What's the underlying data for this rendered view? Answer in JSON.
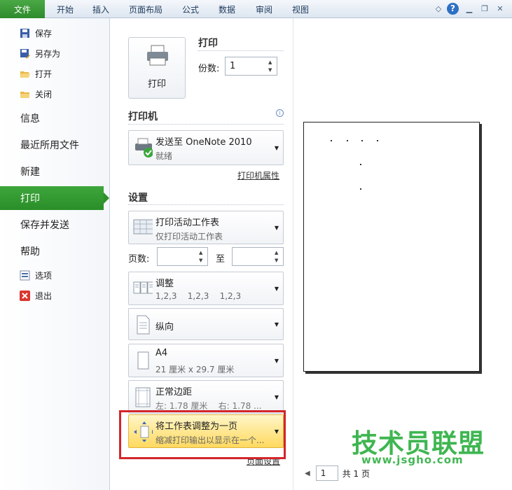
{
  "ribbon": {
    "file": "文件",
    "tabs": [
      "开始",
      "插入",
      "页面布局",
      "公式",
      "数据",
      "审阅",
      "视图"
    ]
  },
  "nav": {
    "small_top": [
      "保存",
      "另存为",
      "打开",
      "关闭"
    ],
    "big": [
      "信息",
      "最近所用文件",
      "新建",
      "打印",
      "保存并发送",
      "帮助"
    ],
    "small_bottom": [
      "选项",
      "退出"
    ]
  },
  "print": {
    "title": "打印",
    "button_label": "打印",
    "copies_label": "份数:",
    "copies_value": "1"
  },
  "printer": {
    "title": "打印机",
    "name": "发送至 OneNote 2010",
    "status": "就绪",
    "properties_link": "打印机属性"
  },
  "settings": {
    "title": "设置",
    "what": {
      "title": "打印活动工作表",
      "desc": "仅打印活动工作表"
    },
    "pages_label": "页数:",
    "to_label": "至",
    "collate": {
      "title": "调整",
      "desc": "1,2,3    1,2,3    1,2,3"
    },
    "orientation": {
      "title": "纵向"
    },
    "paper": {
      "title": "A4",
      "desc": "21 厘米 x 29.7 厘米"
    },
    "margins": {
      "title": "正常边距",
      "desc": "左: 1.78 厘米    右: 1.78 ..."
    },
    "scaling": {
      "title": "将工作表调整为一页",
      "desc": "缩减打印输出以显示在一个..."
    },
    "page_setup_link": "页面设置"
  },
  "preview": {
    "page_value": "1",
    "page_total": "共 1 页"
  },
  "watermark": {
    "title": "技术员联盟",
    "url": "www.jsgho.com"
  },
  "colors": {
    "accent_green": "#2e912c",
    "highlight": "#ffd95e",
    "red_box": "#d3262a"
  }
}
